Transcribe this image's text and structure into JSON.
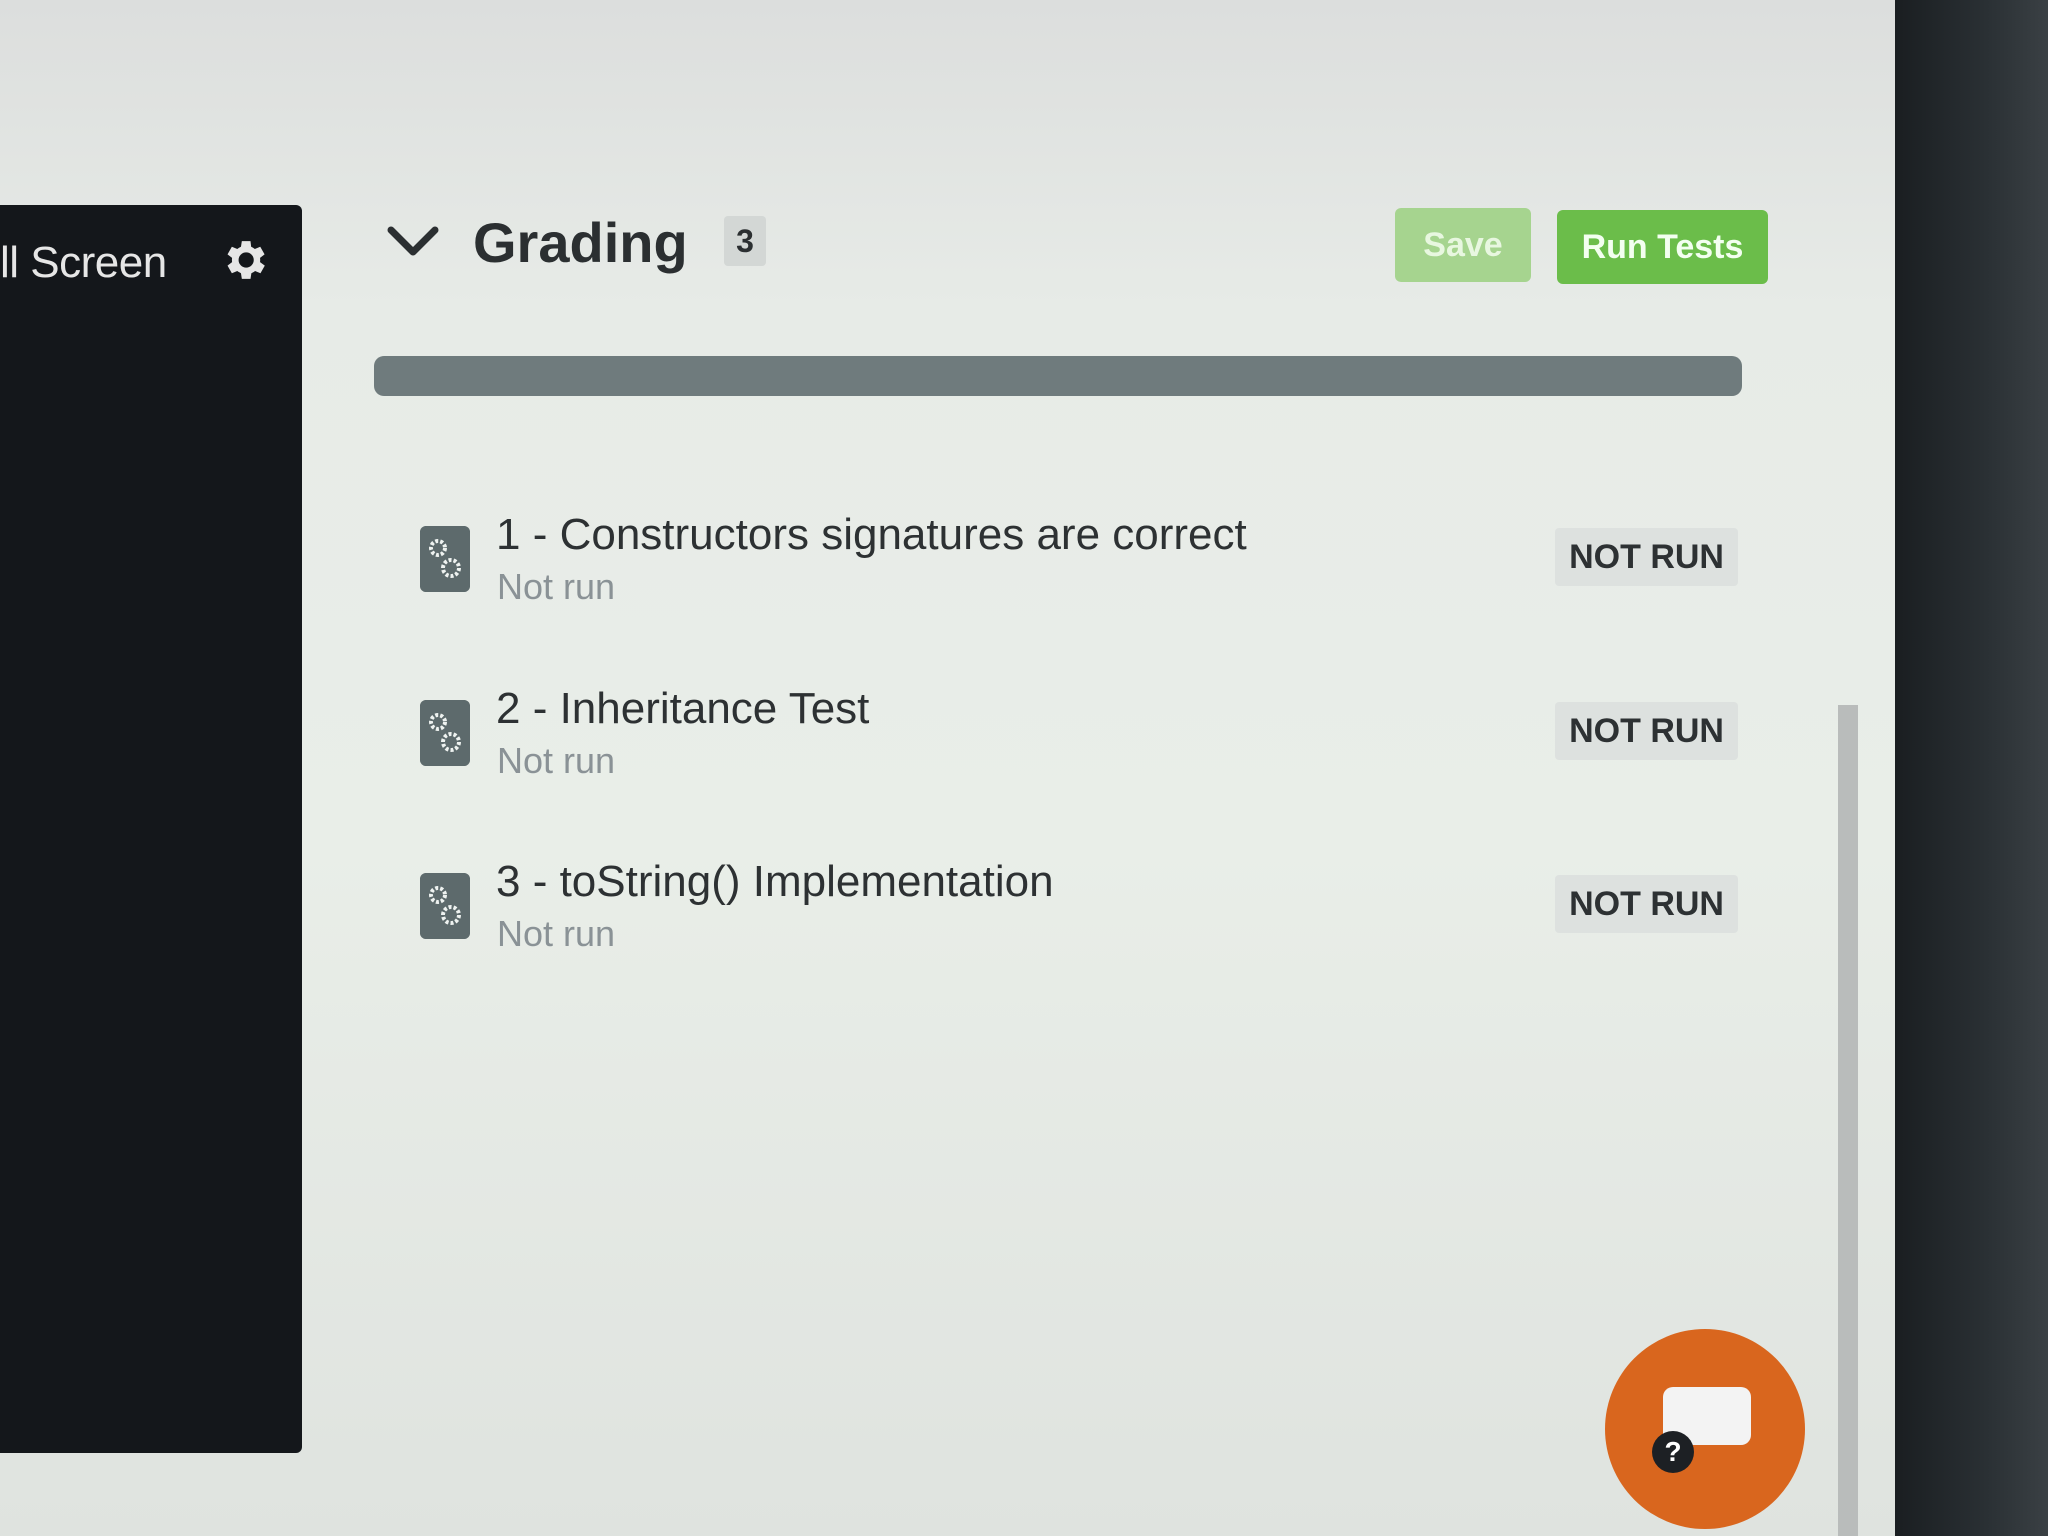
{
  "sidebar": {
    "full_screen_label": "ll Screen",
    "settings_icon": "gear-icon"
  },
  "grading": {
    "title": "Grading",
    "count": "3",
    "save_label": "Save",
    "run_tests_label": "Run Tests",
    "progress": 0
  },
  "tests": [
    {
      "title": "1 - Constructors signatures are correct",
      "status": "Not run",
      "badge": "NOT RUN"
    },
    {
      "title": "2 - Inheritance Test",
      "status": "Not run",
      "badge": "NOT RUN"
    },
    {
      "title": "3 - toString() Implementation",
      "status": "Not run",
      "badge": "NOT RUN"
    }
  ],
  "help": {
    "label": "?"
  },
  "colors": {
    "accent_green": "#6bbd4a",
    "help_orange": "#d9661e",
    "progress_track": "#6f7b7d"
  }
}
